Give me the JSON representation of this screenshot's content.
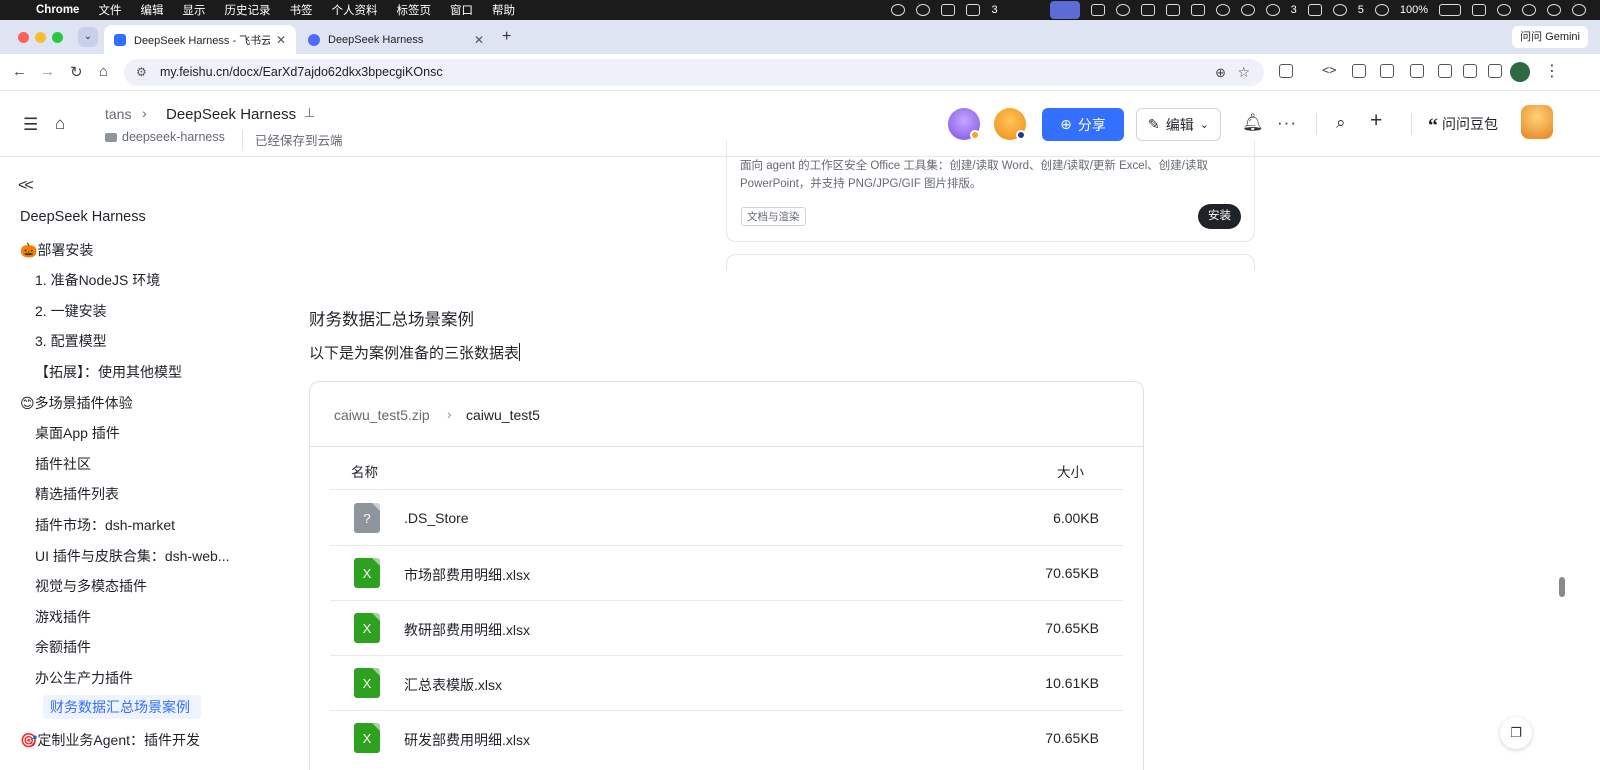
{
  "menubar": {
    "app": "Chrome",
    "items": [
      "文件",
      "编辑",
      "显示",
      "历史记录",
      "书签",
      "个人资料",
      "标签页",
      "窗口",
      "帮助"
    ],
    "status": {
      "badge_shirt": "3",
      "badge_chat": "3",
      "badge_wechat": "5",
      "battery": "100%"
    }
  },
  "browser": {
    "tabs": [
      {
        "title": "DeepSeek Harness - 飞书云文档",
        "active": true,
        "favicon_color": "#3370ff"
      },
      {
        "title": "DeepSeek Harness",
        "active": false,
        "favicon_color": "#4d6bfe"
      }
    ],
    "gemini_label": "问问 Gemini",
    "url": "my.feishu.cn/docx/EarXd7ajdo62dkx3bpecgiKOnsc"
  },
  "doc_header": {
    "breadcrumb_root": "tans",
    "title": "DeepSeek Harness",
    "folder": "deepseek-harness",
    "save_status": "已经保存到云端",
    "share_label": "分享",
    "edit_label": "编辑",
    "ask_label": "问问豆包"
  },
  "sidebar": {
    "doc_title": "DeepSeek Harness",
    "items": [
      {
        "label": "🎃部署安装",
        "level": 1
      },
      {
        "label": "1. 准备NodeJS 环境",
        "level": 2
      },
      {
        "label": "2. 一键安装",
        "level": 2
      },
      {
        "label": "3. 配置模型",
        "level": 2
      },
      {
        "label": "【拓展】：使用其他模型",
        "level": 2
      },
      {
        "label": "😊多场景插件体验",
        "level": 1
      },
      {
        "label": "桌面App 插件",
        "level": 2
      },
      {
        "label": "插件社区",
        "level": 2
      },
      {
        "label": "精选插件列表",
        "level": 2
      },
      {
        "label": "插件市场：dsh-market",
        "level": 2
      },
      {
        "label": "UI 插件与皮肤合集：dsh-web...",
        "level": 2
      },
      {
        "label": "视觉与多模态插件",
        "level": 2
      },
      {
        "label": "游戏插件",
        "level": 2
      },
      {
        "label": "余额插件",
        "level": 2
      },
      {
        "label": "办公生产力插件",
        "level": 2
      },
      {
        "label": "财务数据汇总场景案例",
        "level": 3
      },
      {
        "label": "🎯定制业务Agent：插件开发",
        "level": 1
      }
    ]
  },
  "plugin_card": {
    "description": "面向 agent 的工作区安全 Office 工具集：创建/读取 Word、创建/读取/更新 Excel、创建/读取 PowerPoint，并支持 PNG/JPG/GIF 图片排版。",
    "tag": "文档与渲染",
    "install_label": "安装"
  },
  "content": {
    "heading": "财务数据汇总场景案例",
    "paragraph": "以下是为案例准备的三张数据表"
  },
  "file_browser": {
    "archive": "caiwu_test5.zip",
    "current_folder": "caiwu_test5",
    "columns": {
      "name": "名称",
      "size": "大小"
    },
    "files": [
      {
        "name": ".DS_Store",
        "size": "6.00KB",
        "type": "unknown"
      },
      {
        "name": "市场部费用明细.xlsx",
        "size": "70.65KB",
        "type": "xlsx"
      },
      {
        "name": "教研部费用明细.xlsx",
        "size": "70.65KB",
        "type": "xlsx"
      },
      {
        "name": "汇总表模版.xlsx",
        "size": "10.61KB",
        "type": "xlsx"
      },
      {
        "name": "研发部费用明细.xlsx",
        "size": "70.65KB",
        "type": "xlsx"
      }
    ]
  },
  "icons": {
    "unknown_file": "?",
    "spreadsheet": "X"
  }
}
